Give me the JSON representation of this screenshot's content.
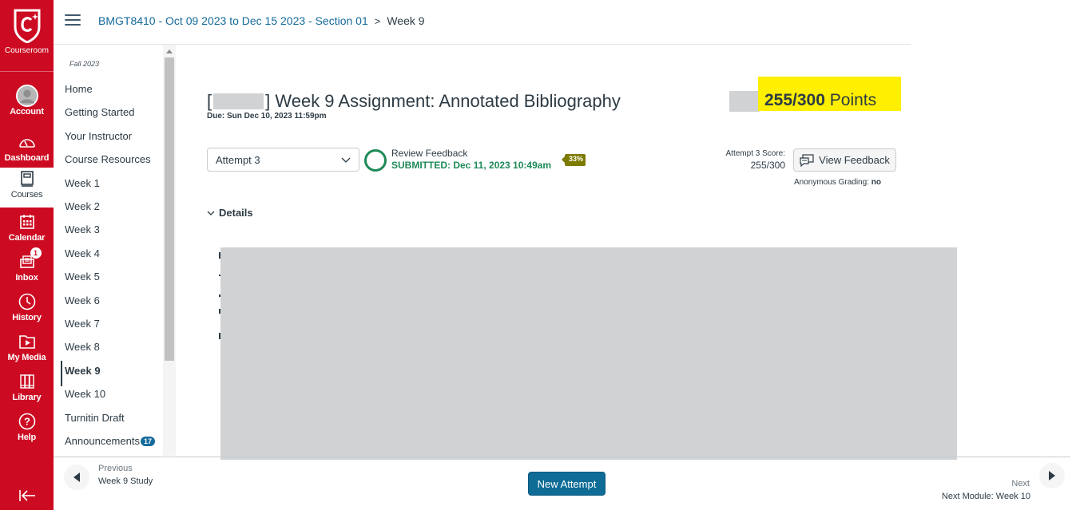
{
  "global_nav": {
    "brand": "Courseroom",
    "items": [
      {
        "label": "Account",
        "icon": "avatar-icon"
      },
      {
        "label": "Dashboard",
        "icon": "speedometer-icon"
      },
      {
        "label": "Courses",
        "icon": "book-icon",
        "active": true
      },
      {
        "label": "Calendar",
        "icon": "calendar-icon"
      },
      {
        "label": "Inbox",
        "icon": "inbox-icon",
        "badge": "1"
      },
      {
        "label": "History",
        "icon": "clock-icon"
      },
      {
        "label": "My Media",
        "icon": "media-folder-icon"
      },
      {
        "label": "Library",
        "icon": "library-icon"
      },
      {
        "label": "Help",
        "icon": "help-icon"
      }
    ],
    "collapse_icon": "collapse-left-icon"
  },
  "header": {
    "breadcrumb": [
      {
        "label": "BMGT8410 - Oct 09 2023 to Dec 15 2023 - Section 01"
      },
      {
        "label": "Week 9"
      }
    ]
  },
  "course_nav": {
    "term": "Fall 2023",
    "items": [
      {
        "label": "Home"
      },
      {
        "label": "Getting Started"
      },
      {
        "label": "Your Instructor"
      },
      {
        "label": "Course Resources"
      },
      {
        "label": "Week 1"
      },
      {
        "label": "Week 2"
      },
      {
        "label": "Week 3"
      },
      {
        "label": "Week 4"
      },
      {
        "label": "Week 5"
      },
      {
        "label": "Week 6"
      },
      {
        "label": "Week 7"
      },
      {
        "label": "Week 8"
      },
      {
        "label": "Week 9",
        "active": true
      },
      {
        "label": "Week 10"
      },
      {
        "label": "Turnitin Draft"
      },
      {
        "label": "Announcements",
        "badge": "17"
      }
    ]
  },
  "assignment": {
    "title_prefix": "[",
    "title_suffix": "] Week 9 Assignment: Annotated Bibliography",
    "due": "Due: Sun Dec 10, 2023 11:59pm",
    "points_value": "255/300",
    "points_label": "Points",
    "attempt_selected": "Attempt 3",
    "review_feedback": "Review Feedback",
    "submitted": "SUBMITTED: Dec 11, 2023 10:49am",
    "similarity": "33%",
    "attempt_score_label": "Attempt 3 Score:",
    "attempt_score_value": "255/300",
    "view_feedback": "View Feedback",
    "anonymous_label": "Anonymous Grading:",
    "anonymous_value": "no",
    "details_label": "Details"
  },
  "footer": {
    "previous_label": "Previous",
    "previous_name": "Week 9 Study",
    "new_attempt": "New Attempt",
    "next_label": "Next",
    "next_name": "Next Module: Week 10"
  }
}
